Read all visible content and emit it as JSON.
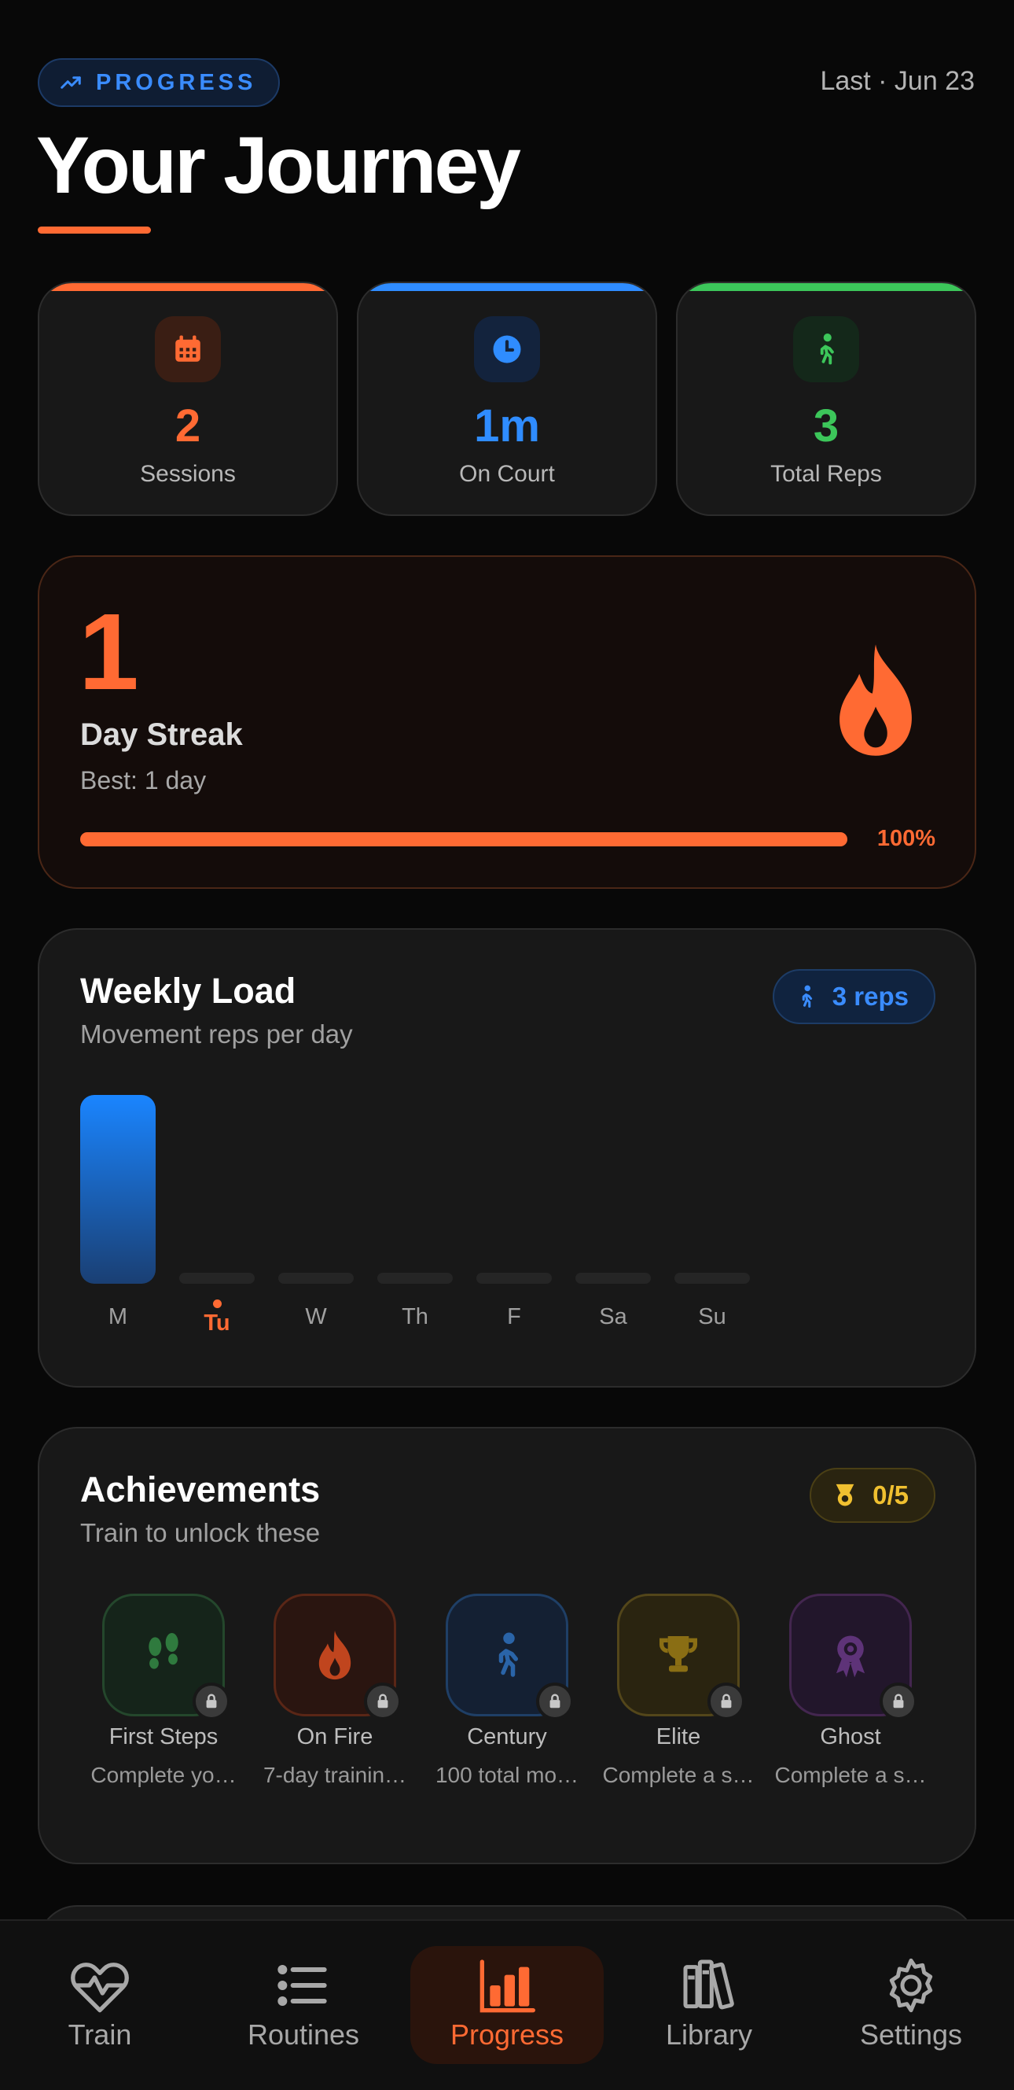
{
  "header": {
    "pill_label": "PROGRESS",
    "last_label": "Last · Jun 23",
    "title": "Your Journey"
  },
  "stats": [
    {
      "value": "2",
      "label": "Sessions",
      "color": "#ff6a33",
      "icon": "calendar-icon"
    },
    {
      "value": "1m",
      "label": "On Court",
      "color": "#2f8cff",
      "icon": "clock-icon"
    },
    {
      "value": "3",
      "label": "Total Reps",
      "color": "#3cc65a",
      "icon": "walking-icon"
    }
  ],
  "streak": {
    "count": "1",
    "label": "Day Streak",
    "best": "Best: 1 day",
    "progress": 1.0,
    "percent_label": "100%"
  },
  "weekly": {
    "title": "Weekly Load",
    "subtitle": "Movement reps per day",
    "badge": "3 reps",
    "days": [
      "M",
      "Tu",
      "W",
      "Th",
      "F",
      "Sa",
      "Su"
    ],
    "values": [
      3,
      0,
      0,
      0,
      0,
      0,
      0
    ],
    "today_index": 1
  },
  "achievements": {
    "title": "Achievements",
    "subtitle": "Train to unlock these",
    "badge": "0/5",
    "items": [
      {
        "name": "First Steps",
        "desc": "Complete yo…",
        "icon": "footprints-icon",
        "color": "#3b9a4a"
      },
      {
        "name": "On Fire",
        "desc": "7-day trainin…",
        "icon": "flame-icon",
        "color": "#e0582a"
      },
      {
        "name": "Century",
        "desc": "100 total mo…",
        "icon": "walking-icon",
        "color": "#2f6fc0"
      },
      {
        "name": "Elite",
        "desc": "Complete a s…",
        "icon": "trophy-icon",
        "color": "#b08a18"
      },
      {
        "name": "Ghost",
        "desc": "Complete a s…",
        "icon": "medal-icon",
        "color": "#7a3ca0"
      }
    ]
  },
  "tabs": [
    {
      "label": "Train",
      "icon": "heart-pulse-icon"
    },
    {
      "label": "Routines",
      "icon": "list-icon"
    },
    {
      "label": "Progress",
      "icon": "bar-chart-icon",
      "active": true
    },
    {
      "label": "Library",
      "icon": "books-icon"
    },
    {
      "label": "Settings",
      "icon": "gear-icon"
    }
  ],
  "colors": {
    "accent": "#ff6a33",
    "blue": "#2f8cff",
    "green": "#3cc65a",
    "gold": "#f0c030"
  }
}
